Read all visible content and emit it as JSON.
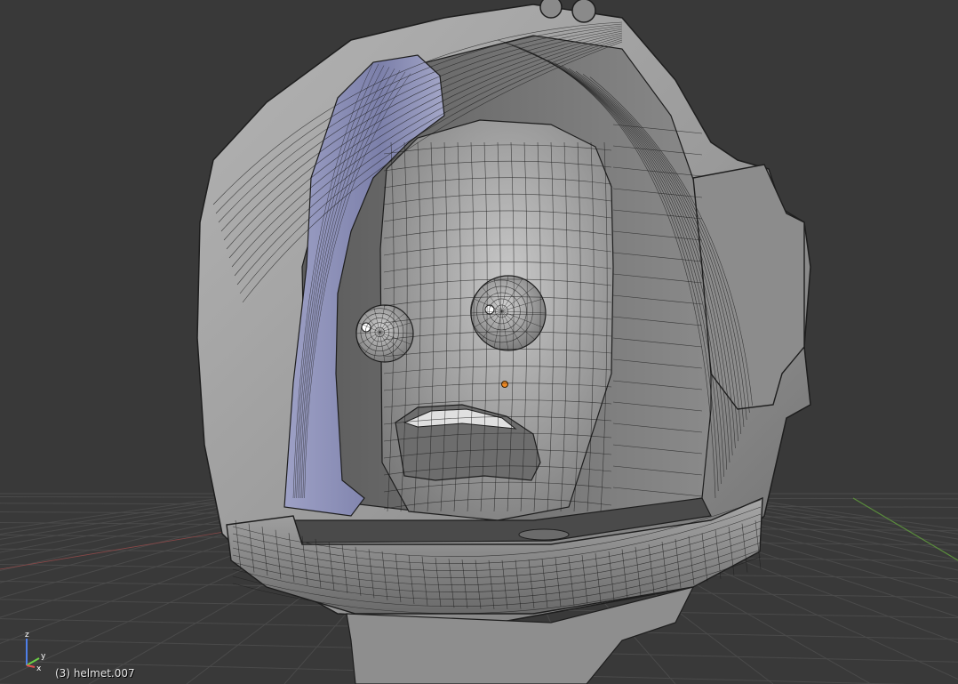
{
  "viewport": {
    "object_info": "(3) helmet.007",
    "background_color": "#393939",
    "grid_color": "#4a4a4a",
    "x_axis_color": "#8a4848",
    "y_axis_color": "#5a8c3c"
  },
  "axis_gizmo": {
    "x_label": "x",
    "y_label": "y",
    "z_label": "z",
    "x_color": "#e05050",
    "y_color": "#6ccf46",
    "z_color": "#4f7fe8"
  },
  "model": {
    "helmet_color": "#9b9b9b",
    "visor_color": "#8c90b8",
    "wire_color": "#1e1e1e",
    "origin_color": "#f08a24"
  }
}
